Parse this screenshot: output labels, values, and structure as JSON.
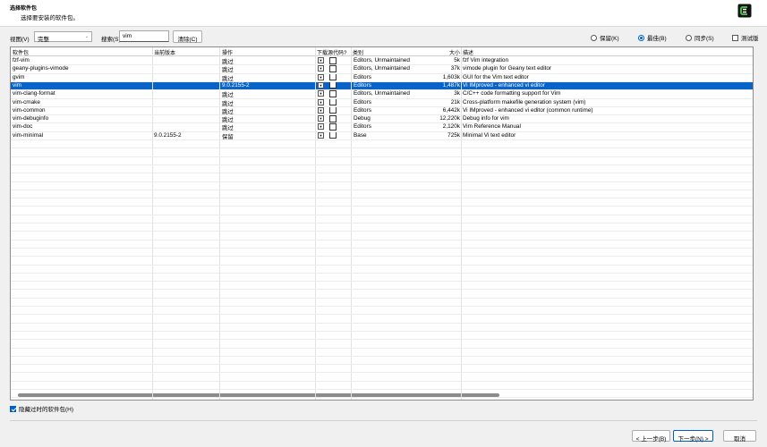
{
  "header": {
    "title": "选择软件包",
    "subtitle": "选择要安装的软件包。"
  },
  "toolbar": {
    "view_label": "视图(V)",
    "view_value": "完整",
    "search_label": "搜索(S)",
    "search_value": "vim",
    "clear_label": "清除(C)",
    "radios": [
      {
        "label": "保留(K)",
        "checked": false
      },
      {
        "label": "最佳(B)",
        "checked": true
      },
      {
        "label": "同步(S)",
        "checked": false
      }
    ],
    "test_label": "测试版"
  },
  "columns": [
    "软件包",
    "当前版本",
    "操作",
    "下载源代码?",
    "类别",
    "大小",
    "描述"
  ],
  "rows": [
    {
      "name": "fzf-vim",
      "current": "",
      "action": "跳过",
      "category": "Editors, Unmaintained",
      "size": "5k",
      "desc": "fzf Vim integration",
      "selected": false
    },
    {
      "name": "geany-plugins-vimode",
      "current": "",
      "action": "跳过",
      "category": "Editors, Unmaintained",
      "size": "37k",
      "desc": "vimode plugin for Geany text editor",
      "selected": false
    },
    {
      "name": "gvim",
      "current": "",
      "action": "跳过",
      "category": "Editors",
      "size": "1,603k",
      "desc": "GUI for the Vim text editor",
      "selected": false
    },
    {
      "name": "vim",
      "current": "",
      "action": "9.0.2155-2",
      "category": "Editors",
      "size": "1,487k",
      "desc": "Vi IMproved - enhanced vi editor",
      "selected": true
    },
    {
      "name": "vim-clang-format",
      "current": "",
      "action": "跳过",
      "category": "Editors, Unmaintained",
      "size": "3k",
      "desc": "C/C++ code formatting support for Vim",
      "selected": false
    },
    {
      "name": "vim-cmake",
      "current": "",
      "action": "跳过",
      "category": "Editors",
      "size": "21k",
      "desc": "Cross-platform makefile generation system (vim)",
      "selected": false
    },
    {
      "name": "vim-common",
      "current": "",
      "action": "跳过",
      "category": "Editors",
      "size": "6,442k",
      "desc": "Vi IMproved - enhanced vi editor (common runtime)",
      "selected": false
    },
    {
      "name": "vim-debuginfo",
      "current": "",
      "action": "跳过",
      "category": "Debug",
      "size": "12,220k",
      "desc": "Debug info for vim",
      "selected": false
    },
    {
      "name": "vim-doc",
      "current": "",
      "action": "跳过",
      "category": "Editors",
      "size": "2,120k",
      "desc": "Vim Reference Manual",
      "selected": false
    },
    {
      "name": "vim-minimal",
      "current": "9.0.2155-2",
      "action": "保留",
      "category": "Base",
      "size": "725k",
      "desc": "Minimal Vi text editor",
      "selected": false
    }
  ],
  "hide_obsolete_label": "隐藏过时的软件包(H)",
  "buttons": {
    "back": "< 上一步(B)",
    "next": "下一步(N) >",
    "cancel": "取消"
  },
  "icons": {
    "logo": "cygwin-logo-icon",
    "dropdown": "dropdown-arrow-icon"
  }
}
